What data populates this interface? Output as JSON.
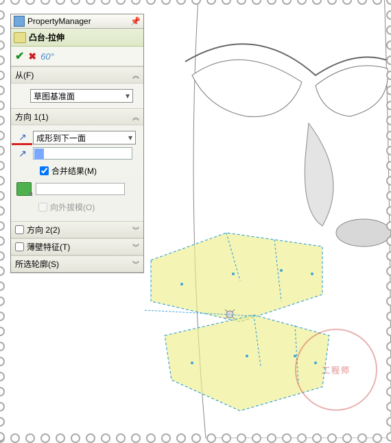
{
  "app": {
    "panel_title": "PropertyManager",
    "feature_name": "凸台-拉伸"
  },
  "actions": {
    "ok": "✓",
    "cancel": "✕",
    "detail": "60°"
  },
  "from_section": {
    "label": "从(F)",
    "value": "草图基准面"
  },
  "direction1": {
    "label": "方向 1(1)",
    "end_condition": "成形到下一面",
    "merge_label": "合并结果(M)",
    "merge_checked": true,
    "draft_label": "向外拔模(O)",
    "draft_checked": false
  },
  "direction2": {
    "label": "方向 2(2)"
  },
  "thin": {
    "label": "薄壁特征(T)"
  },
  "contours": {
    "label": "所选轮廓(S)"
  },
  "watermark": "工程师"
}
